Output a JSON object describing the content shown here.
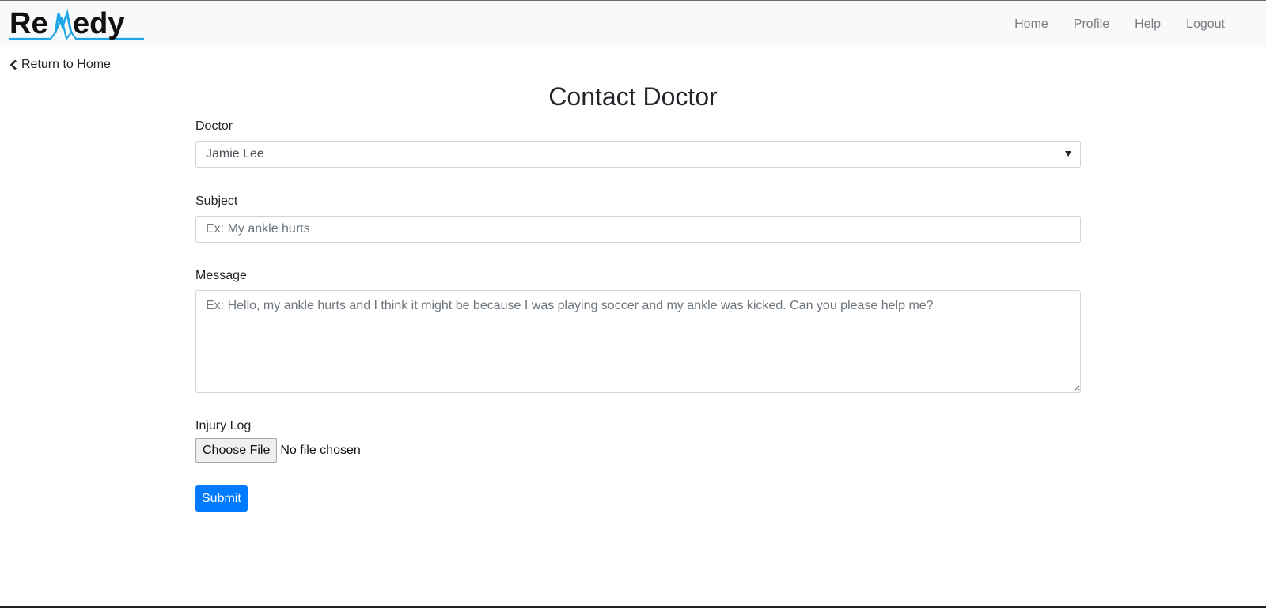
{
  "brand": {
    "name": "ReMedy",
    "text_color": "#111111",
    "accent_color": "#1ea6e8"
  },
  "nav": {
    "items": [
      {
        "label": "Home"
      },
      {
        "label": "Profile"
      },
      {
        "label": "Help"
      },
      {
        "label": "Logout"
      }
    ]
  },
  "return_link": {
    "icon": "chevron-left-icon",
    "label": "Return to Home"
  },
  "page": {
    "title": "Contact Doctor"
  },
  "form": {
    "doctor": {
      "label": "Doctor",
      "selected": "Jamie Lee"
    },
    "subject": {
      "label": "Subject",
      "value": "",
      "placeholder": "Ex: My ankle hurts"
    },
    "message": {
      "label": "Message",
      "value": "",
      "placeholder": "Ex: Hello, my ankle hurts and I think it might be because I was playing soccer and my ankle was kicked. Can you please help me?"
    },
    "injury_log": {
      "label": "Injury Log",
      "button_label": "Choose File",
      "status": "No file chosen"
    },
    "submit_label": "Submit"
  },
  "colors": {
    "primary": "#007bff",
    "navbar_bg": "#f8f9fa",
    "nav_link": "#7a7d80"
  }
}
